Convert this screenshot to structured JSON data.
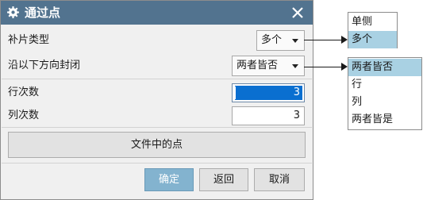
{
  "dialog": {
    "title": "通过点",
    "patch_type_label": "补片类型",
    "patch_type_value": "多个",
    "close_along_label": "沿以下方向封闭",
    "close_along_value": "两者皆否",
    "row_count_label": "行次数",
    "row_count_value": "3",
    "col_count_label": "列次数",
    "col_count_value": "3",
    "points_from_file": "文件中的点",
    "ok": "确定",
    "back": "返回",
    "cancel": "取消"
  },
  "patch_type_options": [
    "单侧",
    "多个"
  ],
  "close_along_options": [
    "两者皆否",
    "行",
    "列",
    "两者皆是"
  ],
  "colors": {
    "titlebar": "#52738f",
    "selection": "#0a6fd0",
    "menu_highlight": "#a9d1e3",
    "ok_button": "#83b3cf"
  }
}
